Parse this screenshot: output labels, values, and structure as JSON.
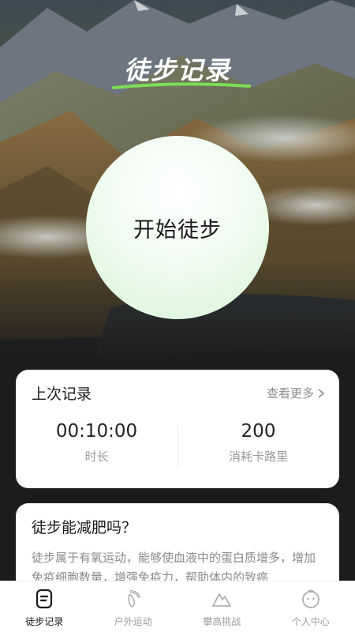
{
  "header": {
    "title": "徒步记录"
  },
  "start": {
    "label": "开始徒步"
  },
  "last_record": {
    "title": "上次记录",
    "more_label": "查看更多",
    "stats": [
      {
        "value": "00:10:00",
        "label": "时长"
      },
      {
        "value": "200",
        "label": "消耗卡路里"
      }
    ]
  },
  "article": {
    "title": "徒步能减肥吗？",
    "body": "徒步属于有氧运动，能够使血液中的蛋白质增多，增加免疫细胞数量，增强免疫力，帮助体内的致癌"
  },
  "tabbar": {
    "items": [
      {
        "label": "徒步记录",
        "icon": "note-icon",
        "active": true
      },
      {
        "label": "户外运动",
        "icon": "footprint-icon",
        "active": false
      },
      {
        "label": "攀高挑战",
        "icon": "mountain-icon",
        "active": false
      },
      {
        "label": "个人中心",
        "icon": "face-icon",
        "active": false
      }
    ]
  },
  "colors": {
    "accent_green": "#7ddc57",
    "circle_fill": "#e4f8e2",
    "card_bg": "#ffffff",
    "muted_text": "#9a9a9a"
  }
}
